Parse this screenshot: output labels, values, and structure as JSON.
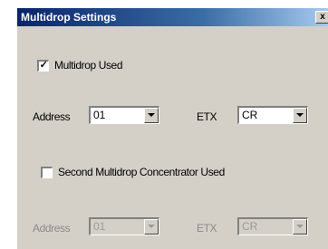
{
  "window": {
    "title": "Multidrop Settings",
    "close_label": "x"
  },
  "multidrop": {
    "checkbox_label": "Multidrop Used",
    "checked": true,
    "check_mark": "✓",
    "address_label": "Address",
    "address_value": "01",
    "etx_label": "ETX",
    "etx_value": "CR"
  },
  "concentrator": {
    "checkbox_label": "Second Multidrop Concentrator Used",
    "checked": false,
    "address_label": "Address",
    "address_value": "01",
    "etx_label": "ETX",
    "etx_value": "CR"
  }
}
